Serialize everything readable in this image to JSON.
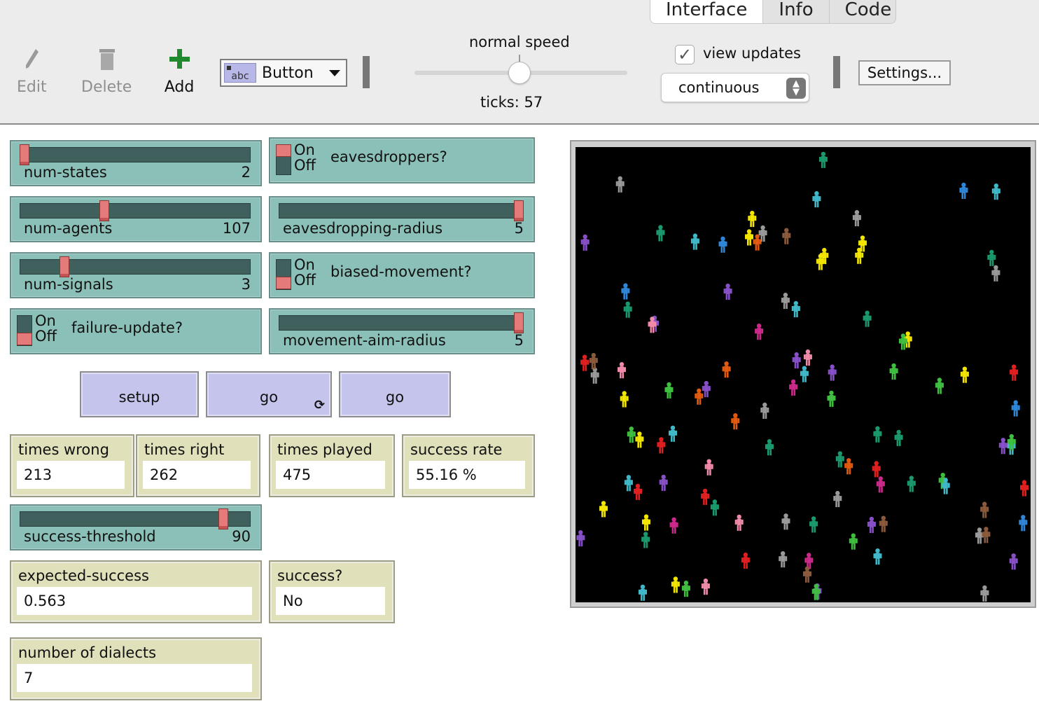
{
  "tabs": {
    "interface": "Interface",
    "info": "Info",
    "code": "Code"
  },
  "toolbar": {
    "edit_label": "Edit",
    "delete_label": "Delete",
    "add_label": "Add",
    "widget_type": "Button",
    "speed_label": "normal speed",
    "ticks_label": "ticks: 57",
    "view_updates_label": "view updates",
    "view_updates_checked": true,
    "update_mode": "continuous",
    "settings_label": "Settings..."
  },
  "sliders": {
    "num_states": {
      "name": "num-states",
      "value": "2",
      "fraction": 0.0
    },
    "num_agents": {
      "name": "num-agents",
      "value": "107",
      "fraction": 0.36
    },
    "num_signals": {
      "name": "num-signals",
      "value": "3",
      "fraction": 0.18
    },
    "eavesdropping_radius": {
      "name": "eavesdropping-radius",
      "value": "5",
      "fraction": 1.0
    },
    "movement_aim_radius": {
      "name": "movement-aim-radius",
      "value": "5",
      "fraction": 1.0
    },
    "success_threshold": {
      "name": "success-threshold",
      "value": "90",
      "fraction": 0.9
    }
  },
  "switches": {
    "on_label": "On",
    "off_label": "Off",
    "eavesdroppers": {
      "name": "eavesdroppers?",
      "state": "on"
    },
    "biased_movement": {
      "name": "biased-movement?",
      "state": "off"
    },
    "failure_update": {
      "name": "failure-update?",
      "state": "off"
    }
  },
  "buttons": {
    "setup": "setup",
    "go_forever": "go",
    "go_once": "go"
  },
  "monitors": {
    "times_wrong": {
      "name": "times wrong",
      "value": "213"
    },
    "times_right": {
      "name": "times right",
      "value": "262"
    },
    "times_played": {
      "name": "times played",
      "value": "475"
    },
    "success_rate": {
      "name": "success rate",
      "value": "55.16 %"
    },
    "expected_success": {
      "name": "expected-success",
      "value": "0.563"
    },
    "success": {
      "name": "success?",
      "value": "No"
    },
    "number_of_dialects": {
      "name": "number of dialects",
      "value": "7"
    }
  },
  "colors": {
    "slider_bg": "#8bc0b8",
    "button_bg": "#c4c4ec",
    "monitor_bg": "#e0e0bb",
    "world_bg": "#000000"
  },
  "agent_palette": [
    "#f2e600",
    "#2f86d8",
    "#8b5a3c",
    "#1a9a6c",
    "#cc2a8a",
    "#e05a10",
    "#f08aa8",
    "#3fbf3f",
    "#e02020",
    "#8850c8",
    "#40b8c8",
    "#999999"
  ]
}
